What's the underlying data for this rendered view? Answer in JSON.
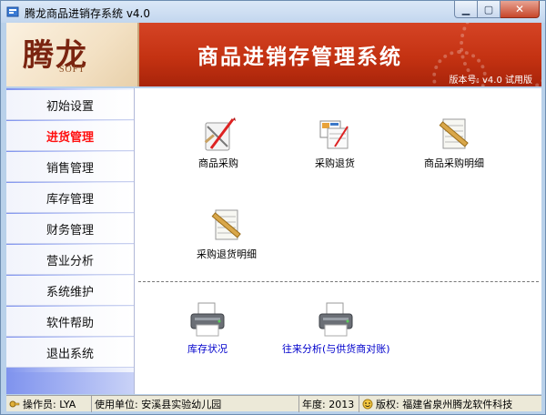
{
  "window": {
    "title": "腾龙商品进销存系统 v4.0"
  },
  "banner": {
    "logo_text": "腾龙",
    "logo_sub": "SOFT",
    "title": "商品进销存管理系统",
    "version": "版本号: v4.0 试用版"
  },
  "sidebar": {
    "items": [
      {
        "label": "初始设置",
        "active": false
      },
      {
        "label": "进货管理",
        "active": true
      },
      {
        "label": "销售管理",
        "active": false
      },
      {
        "label": "库存管理",
        "active": false
      },
      {
        "label": "财务管理",
        "active": false
      },
      {
        "label": "营业分析",
        "active": false
      },
      {
        "label": "系统维护",
        "active": false
      },
      {
        "label": "软件帮助",
        "active": false
      },
      {
        "label": "退出系统",
        "active": false
      }
    ]
  },
  "main": {
    "tools": [
      {
        "label": "商品采购",
        "icon": "drafting-tools-icon"
      },
      {
        "label": "采购退货",
        "icon": "return-document-icon"
      },
      {
        "label": "商品采购明细",
        "icon": "ruled-ledger-icon"
      },
      {
        "label": "采购退货明细",
        "icon": "ruled-ledger-icon"
      }
    ],
    "reports": [
      {
        "label": "库存状况",
        "icon": "printer-icon"
      },
      {
        "label": "往来分析(与供货商对账)",
        "icon": "printer-icon"
      }
    ]
  },
  "statusbar": {
    "operator": "操作员: LYA",
    "unit": "使用单位: 安溪县实验幼儿园",
    "year": "年度: 2013",
    "copyright": "版权: 福建省泉州腾龙软件科技"
  },
  "colors": {
    "banner": "#c43212",
    "active_menu": "#ff1010",
    "report_link": "#0000cc"
  }
}
